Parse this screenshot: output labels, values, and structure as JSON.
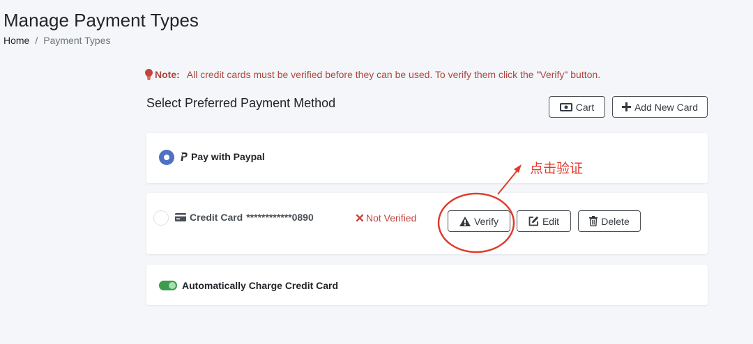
{
  "page": {
    "title": "Manage Payment Types",
    "breadcrumb": {
      "home": "Home",
      "separator": "/",
      "current": "Payment Types"
    }
  },
  "note": {
    "label": "Note:",
    "text": "All credit cards must be verified before they can be used. To verify them click the \"Verify\" button."
  },
  "section": {
    "heading": "Select Preferred Payment Method"
  },
  "toolbar": {
    "cart_label": "Cart",
    "add_card_label": "Add New Card"
  },
  "payment_methods": {
    "paypal": {
      "label": "Pay with Paypal",
      "selected": true
    },
    "credit_card": {
      "label": "Credit Card",
      "number": "************0890",
      "selected": false,
      "status": "Not Verified",
      "verify_label": "Verify",
      "edit_label": "Edit",
      "delete_label": "Delete"
    }
  },
  "auto_charge": {
    "label": "Automatically Charge Credit Card",
    "enabled": true
  },
  "annotation": {
    "text": "点击验证",
    "color": "#e03b2c"
  },
  "colors": {
    "accent": "#4e71c4",
    "danger": "#c0453d",
    "toggle_on": "#3e9b4d"
  }
}
